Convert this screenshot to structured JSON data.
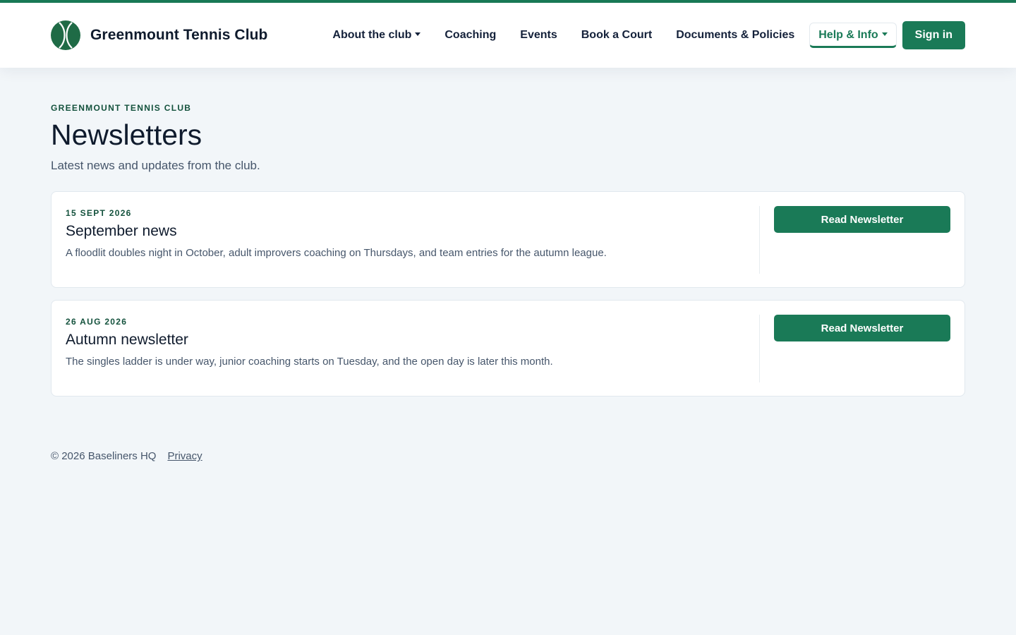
{
  "colors": {
    "accent": "#1a7a57",
    "background": "#f2f6f9",
    "text": "#0f1b2d",
    "muted": "#46566b"
  },
  "header": {
    "logo_icon": "tennis-ball-icon",
    "brand_name": "Greenmount Tennis Club",
    "nav": [
      {
        "label": "About the club",
        "dropdown": true
      },
      {
        "label": "Coaching"
      },
      {
        "label": "Events"
      },
      {
        "label": "Book a Court"
      },
      {
        "label": "Documents & Policies"
      },
      {
        "label": "Help & Info",
        "dropdown": true,
        "active": true
      }
    ],
    "signin_label": "Sign in"
  },
  "main": {
    "eyebrow": "GREENMOUNT TENNIS CLUB",
    "title": "Newsletters",
    "subtitle": "Latest news and updates from the club.",
    "newsletters": [
      {
        "date": "15 SEPT 2026",
        "title": "September news",
        "summary": "A floodlit doubles night in October, adult improvers coaching on Thursdays, and team entries for the autumn league.",
        "button_label": "Read Newsletter"
      },
      {
        "date": "26 AUG 2026",
        "title": "Autumn newsletter",
        "summary": "The singles ladder is under way, junior coaching starts on Tuesday, and the open day is later this month.",
        "button_label": "Read Newsletter"
      }
    ]
  },
  "footer": {
    "copyright": "© 2026 Baseliners HQ",
    "privacy_label": "Privacy"
  }
}
